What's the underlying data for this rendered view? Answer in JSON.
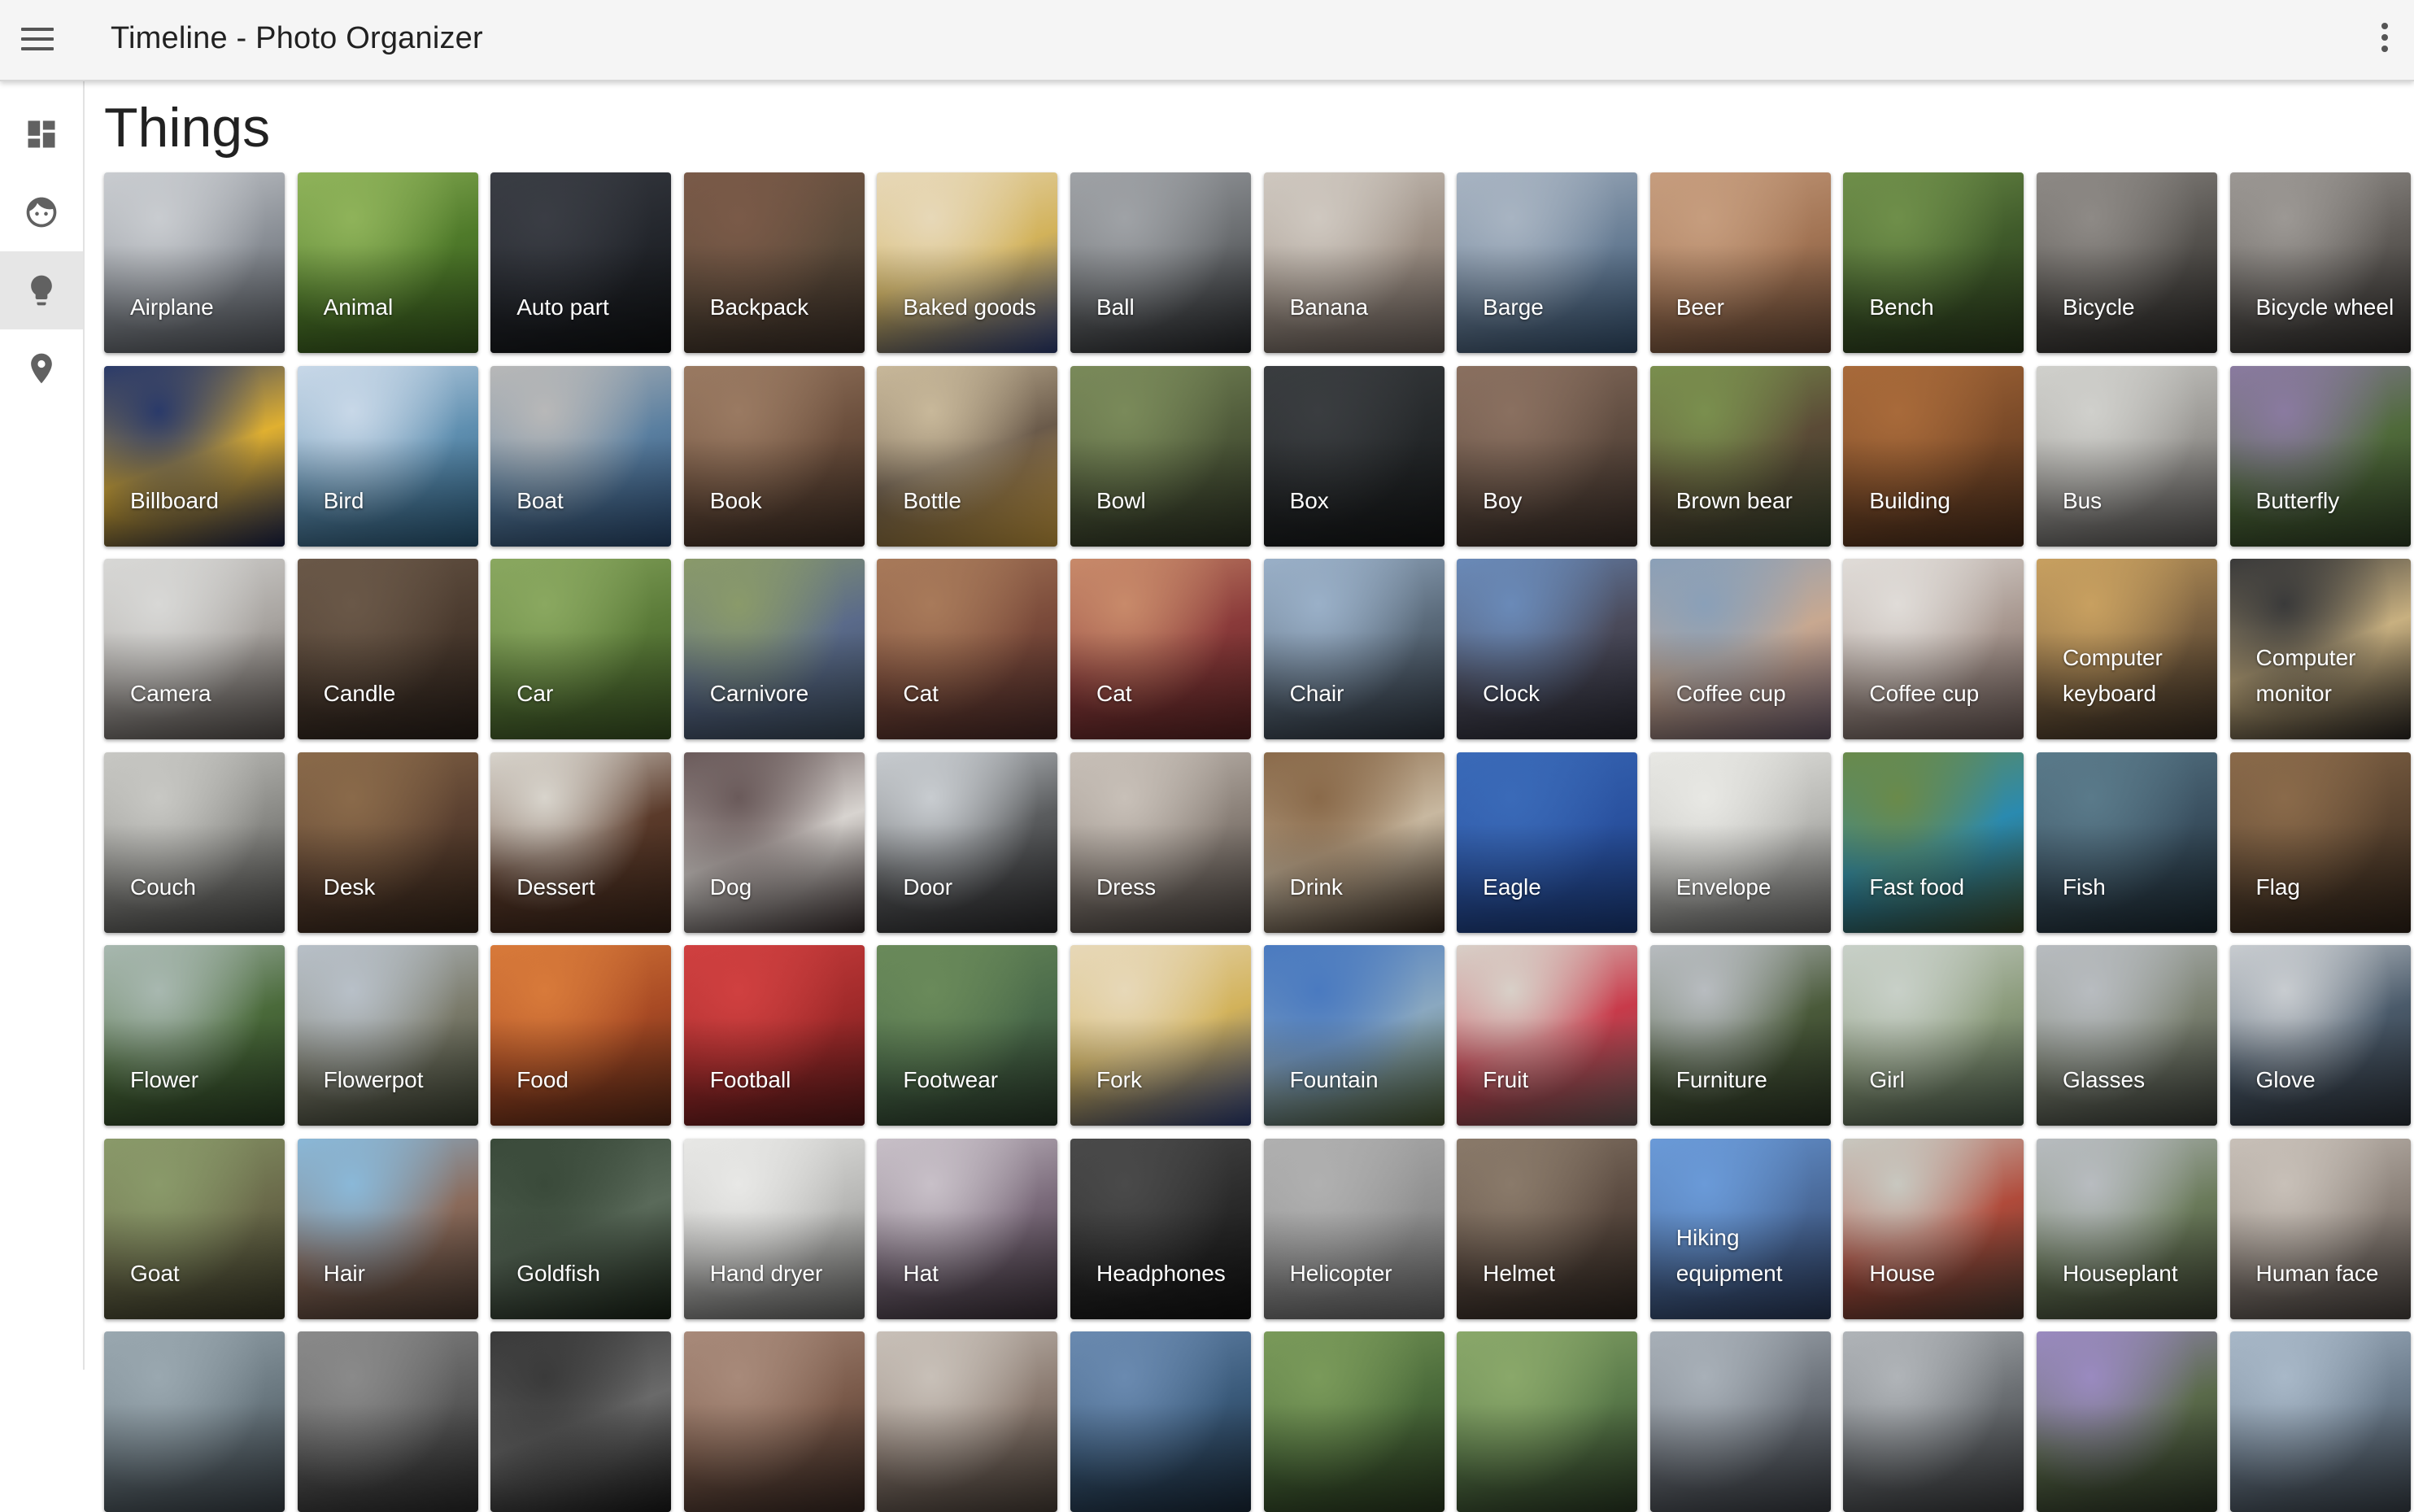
{
  "app": {
    "title": "Timeline - Photo Organizer"
  },
  "page": {
    "title": "Things"
  },
  "sidebar": {
    "items": [
      {
        "icon": "dashboard-icon",
        "active": false
      },
      {
        "icon": "face-icon",
        "active": false
      },
      {
        "icon": "lightbulb-icon",
        "active": true
      },
      {
        "icon": "place-icon",
        "active": false
      }
    ]
  },
  "tiles": [
    {
      "label": "Airplane",
      "colors": [
        "#c9ccd0",
        "#8a8f96",
        "#54585e"
      ]
    },
    {
      "label": "Animal",
      "colors": [
        "#8fb35a",
        "#4f7a2a",
        "#34561c"
      ]
    },
    {
      "label": "Auto part",
      "colors": [
        "#3a3d44",
        "#23262c",
        "#101214"
      ]
    },
    {
      "label": "Backpack",
      "colors": [
        "#7a5a48",
        "#5b4a3a",
        "#3a2e26"
      ]
    },
    {
      "label": "Baked goods",
      "colors": [
        "#e7d8b8",
        "#d2b25a",
        "#2e3f7a"
      ]
    },
    {
      "label": "Ball",
      "colors": [
        "#9fa2a6",
        "#6a6d70",
        "#26282b"
      ]
    },
    {
      "label": "Banana",
      "colors": [
        "#cfc8c0",
        "#9c8f84",
        "#6a605a"
      ]
    },
    {
      "label": "Barge",
      "colors": [
        "#a8b4c2",
        "#6a7f96",
        "#34506e"
      ]
    },
    {
      "label": "Beer",
      "colors": [
        "#c69d7e",
        "#a27454",
        "#6a4a36"
      ]
    },
    {
      "label": "Bench",
      "colors": [
        "#6f8f4a",
        "#3f5a2a",
        "#2a3a1c"
      ]
    },
    {
      "label": "Bicycle",
      "colors": [
        "#8e8a86",
        "#55524e",
        "#2a2826"
      ]
    },
    {
      "label": "Bicycle wheel",
      "colors": [
        "#9c9894",
        "#5f5b57",
        "#2e2c2a"
      ]
    },
    {
      "label": "Billboard",
      "colors": [
        "#2a3a6a",
        "#e0b030",
        "#1c244a"
      ]
    },
    {
      "label": "Bird",
      "colors": [
        "#c8d8e8",
        "#5f8fb0",
        "#2a5a7a"
      ]
    },
    {
      "label": "Boat",
      "colors": [
        "#b8b8b8",
        "#5a7fa0",
        "#2a4a70"
      ]
    },
    {
      "label": "Book",
      "colors": [
        "#9a7a62",
        "#6a4e3c",
        "#3e2e24"
      ]
    },
    {
      "label": "Bottle",
      "colors": [
        "#c8b89a",
        "#6a5a4a",
        "#d0a040"
      ]
    },
    {
      "label": "Bowl",
      "colors": [
        "#7a8a5a",
        "#4f5a3a",
        "#2e3424"
      ]
    },
    {
      "label": "Box",
      "colors": [
        "#3a3d40",
        "#25282a",
        "#151718"
      ]
    },
    {
      "label": "Boy",
      "colors": [
        "#8a7060",
        "#5f4c40",
        "#3a2e28"
      ]
    },
    {
      "label": "Brown bear",
      "colors": [
        "#7a8f4e",
        "#5a4a36",
        "#34402a"
      ]
    },
    {
      "label": "Building",
      "colors": [
        "#a86a3a",
        "#7a4a28",
        "#4a2e1c"
      ]
    },
    {
      "label": "Bus",
      "colors": [
        "#d0d0cc",
        "#9a9894",
        "#5a5856"
      ]
    },
    {
      "label": "Butterfly",
      "colors": [
        "#8a7aa0",
        "#4f6a3a",
        "#2e3e24"
      ]
    },
    {
      "label": "Camera",
      "colors": [
        "#d8d8d6",
        "#a8a4a0",
        "#5a5450"
      ]
    },
    {
      "label": "Candle",
      "colors": [
        "#6a5848",
        "#4a3a2e",
        "#2a201a"
      ]
    },
    {
      "label": "Car",
      "colors": [
        "#8aa860",
        "#5a7a38",
        "#3a5424"
      ]
    },
    {
      "label": "Carnivore",
      "colors": [
        "#8a9a6a",
        "#5a6a8a",
        "#3a4a5a"
      ]
    },
    {
      "label": "Cat",
      "colors": [
        "#a87a5a",
        "#7a4a3a",
        "#4a2a28"
      ]
    },
    {
      "label": "Cat",
      "colors": [
        "#c88a6a",
        "#8a3a3a",
        "#5a2424"
      ]
    },
    {
      "label": "Chair",
      "colors": [
        "#9ab0c8",
        "#5a6a7a",
        "#2e3640"
      ]
    },
    {
      "label": "Clock",
      "colors": [
        "#6a8ab8",
        "#4a4a5a",
        "#2a2a34"
      ]
    },
    {
      "label": "Coffee cup",
      "colors": [
        "#8aa0b8",
        "#c8a890",
        "#6a5a6a"
      ]
    },
    {
      "label": "Coffee cup",
      "colors": [
        "#e0dcd8",
        "#a89890",
        "#6a5a56"
      ]
    },
    {
      "label": "Computer keyboard",
      "colors": [
        "#c8a060",
        "#7a6040",
        "#3a2e22"
      ]
    },
    {
      "label": "Computer monitor",
      "colors": [
        "#3a3a3a",
        "#c8b080",
        "#2a2622"
      ]
    },
    {
      "label": "Couch",
      "colors": [
        "#c8c8c4",
        "#8a8a86",
        "#4a4a48"
      ]
    },
    {
      "label": "Desk",
      "colors": [
        "#8a6a4a",
        "#5a4030",
        "#342418"
      ]
    },
    {
      "label": "Dessert",
      "colors": [
        "#d8d4cc",
        "#5a3a2a",
        "#3a2418"
      ]
    },
    {
      "label": "Dog",
      "colors": [
        "#6a5a5a",
        "#d8d4d0",
        "#3a3030"
      ]
    },
    {
      "label": "Door",
      "colors": [
        "#c8ccd0",
        "#5a5c5e",
        "#2a2a2c"
      ]
    },
    {
      "label": "Dress",
      "colors": [
        "#c8c0b8",
        "#8a8078",
        "#4a4440"
      ]
    },
    {
      "label": "Drink",
      "colors": [
        "#8a6a4a",
        "#c8b8a0",
        "#3a2c20"
      ]
    },
    {
      "label": "Eagle",
      "colors": [
        "#3a6ab8",
        "#2a52a0",
        "#1a3a7a"
      ]
    },
    {
      "label": "Envelope",
      "colors": [
        "#e8e8e4",
        "#b8b8b4",
        "#6a6a68"
      ]
    },
    {
      "label": "Fast food",
      "colors": [
        "#6a8a4a",
        "#2a8ab0",
        "#3a4a2a"
      ]
    },
    {
      "label": "Fish",
      "colors": [
        "#5a7a8a",
        "#3a5060",
        "#1a2830"
      ]
    },
    {
      "label": "Flag",
      "colors": [
        "#8a6a4a",
        "#5a4430",
        "#2e2218"
      ]
    },
    {
      "label": "Flower",
      "colors": [
        "#a8b8b0",
        "#4a6a3a",
        "#2a4024"
      ]
    },
    {
      "label": "Flowerpot",
      "colors": [
        "#b8c0c8",
        "#7a7a6a",
        "#3a4030"
      ]
    },
    {
      "label": "Food",
      "colors": [
        "#d87a3a",
        "#a84a24",
        "#5a2a18"
      ]
    },
    {
      "label": "Football",
      "colors": [
        "#d04040",
        "#a02a2a",
        "#5a1a1a"
      ]
    },
    {
      "label": "Footwear",
      "colors": [
        "#6a8a5a",
        "#4a6a4a",
        "#2a3a2a"
      ]
    },
    {
      "label": "Fork",
      "colors": [
        "#e7d8b8",
        "#d2b25a",
        "#2e3f7a"
      ]
    },
    {
      "label": "Fountain",
      "colors": [
        "#4a7ac0",
        "#8aa8c0",
        "#4a5a34"
      ]
    },
    {
      "label": "Fruit",
      "colors": [
        "#d8d0c8",
        "#c83a4a",
        "#6a5a58"
      ]
    },
    {
      "label": "Furniture",
      "colors": [
        "#b8bcc0",
        "#4a5a3a",
        "#2a3424"
      ]
    },
    {
      "label": "Girl",
      "colors": [
        "#c8d0c8",
        "#8a9a7a",
        "#4a5a4a"
      ]
    },
    {
      "label": "Glasses",
      "colors": [
        "#b8bcc0",
        "#7a8070",
        "#3a3e38"
      ]
    },
    {
      "label": "Glove",
      "colors": [
        "#c8ccd0",
        "#4a5a6a",
        "#2a3038"
      ]
    },
    {
      "label": "Goat",
      "colors": [
        "#8a9a6a",
        "#6a6a4a",
        "#3a3a28"
      ]
    },
    {
      "label": "Hair",
      "colors": [
        "#8ab8d8",
        "#8a6a5a",
        "#4a3a30"
      ]
    },
    {
      "label": "Goldfish",
      "colors": [
        "#3a4a3a",
        "#5a6a5a",
        "#1a2418"
      ]
    },
    {
      "label": "Hand dryer",
      "colors": [
        "#e8e8e6",
        "#b8b8b6",
        "#6a6a68"
      ]
    },
    {
      "label": "Hat",
      "colors": [
        "#c8c0c8",
        "#7a6a7a",
        "#3a3038"
      ]
    },
    {
      "label": "Headphones",
      "colors": [
        "#4a4a4a",
        "#2a2a2a",
        "#121212"
      ]
    },
    {
      "label": "Helicopter",
      "colors": [
        "#b0b0b0",
        "#909090",
        "#6a6a6a"
      ]
    },
    {
      "label": "Helmet",
      "colors": [
        "#8a7a6a",
        "#5a4a40",
        "#2e2620"
      ]
    },
    {
      "label": "Hiking equipment",
      "colors": [
        "#6a9ad8",
        "#4a6a9a",
        "#2a3a5a"
      ]
    },
    {
      "label": "House",
      "colors": [
        "#c8c8c0",
        "#b04a3a",
        "#4a3a30"
      ]
    },
    {
      "label": "Houseplant",
      "colors": [
        "#b8bcc0",
        "#6a7a5a",
        "#3a4030"
      ]
    },
    {
      "label": "Human face",
      "colors": [
        "#c8c0b8",
        "#8a8078",
        "#4a4440"
      ]
    },
    {
      "label": "",
      "colors": [
        "#9aa8b0",
        "#6a7880",
        "#3a4248"
      ]
    },
    {
      "label": "",
      "colors": [
        "#8a8a8a",
        "#5a5a5a",
        "#2a2a2a"
      ]
    },
    {
      "label": "",
      "colors": [
        "#3a3a3a",
        "#6a6a6a",
        "#1a1a1a"
      ]
    },
    {
      "label": "",
      "colors": [
        "#a88a7a",
        "#7a5a4a",
        "#3a2a24"
      ]
    },
    {
      "label": "",
      "colors": [
        "#c8c0b8",
        "#8a7a70",
        "#4a4038"
      ]
    },
    {
      "label": "",
      "colors": [
        "#6a8ab0",
        "#3a5a7a",
        "#1a2a3a"
      ]
    },
    {
      "label": "",
      "colors": [
        "#7a9a5a",
        "#4a6a3a",
        "#2a3a20"
      ]
    },
    {
      "label": "",
      "colors": [
        "#8aa86a",
        "#5a7a4a",
        "#2a3a24"
      ]
    },
    {
      "label": "",
      "colors": [
        "#a8b0b8",
        "#6a7078",
        "#3a3e44"
      ]
    },
    {
      "label": "",
      "colors": [
        "#b0b4b8",
        "#6a6e72",
        "#3a3c3e"
      ]
    },
    {
      "label": "",
      "colors": [
        "#9a8ac0",
        "#5a6a4a",
        "#2a3424"
      ]
    },
    {
      "label": "",
      "colors": [
        "#a8b8c8",
        "#6a7a8a",
        "#3a424a"
      ]
    }
  ]
}
